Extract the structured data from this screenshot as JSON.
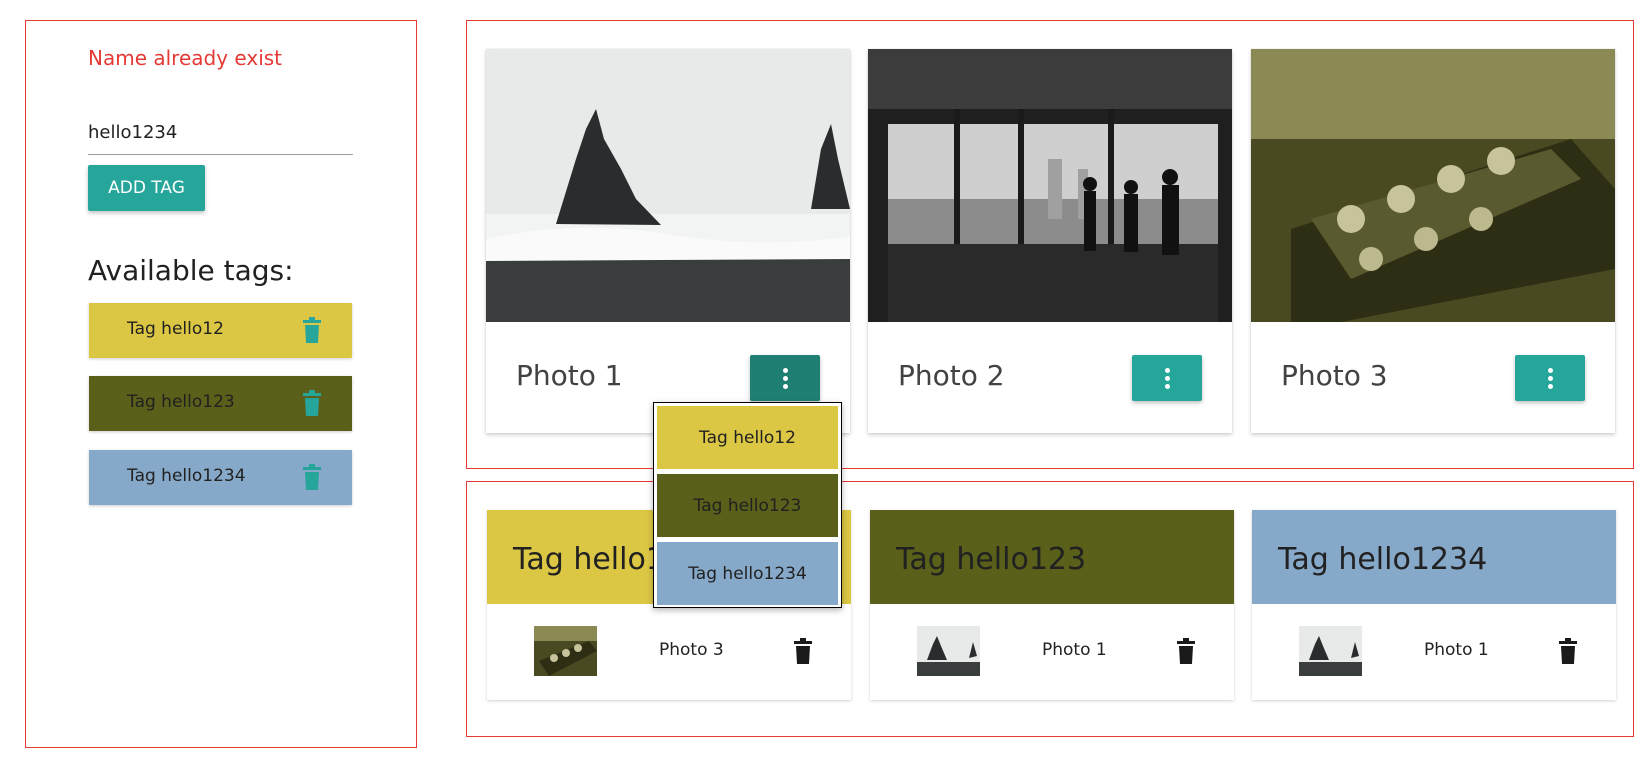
{
  "form": {
    "error_message": "Name already exist",
    "tag_input_value": "hello1234",
    "add_button_label": "ADD TAG"
  },
  "available_tags": {
    "heading": "Available tags:",
    "items": [
      {
        "label": "Tag hello12",
        "color": "#dcc744"
      },
      {
        "label": "Tag hello123",
        "color": "#5a5f19"
      },
      {
        "label": "Tag hello1234",
        "color": "#87a9c9"
      }
    ]
  },
  "photos": [
    {
      "title": "Photo 1",
      "image": "beach-rocks-photo"
    },
    {
      "title": "Photo 2",
      "image": "city-window-photo"
    },
    {
      "title": "Photo 3",
      "image": "guitar-headstock-photo"
    }
  ],
  "tag_menu": {
    "items": [
      "Tag hello12",
      "Tag hello123",
      "Tag hello1234"
    ]
  },
  "tag_groups": [
    {
      "title": "Tag hello1",
      "color": "#dcc744",
      "photo": "Photo 3"
    },
    {
      "title": "Tag hello123",
      "color": "#5a5f19",
      "photo": "Photo 1"
    },
    {
      "title": "Tag hello1234",
      "color": "#87a9c9",
      "photo": "Photo 1"
    }
  ],
  "colors": {
    "accent": "#26a69a",
    "accent_active": "#1f7f73",
    "error": "#e53935"
  }
}
